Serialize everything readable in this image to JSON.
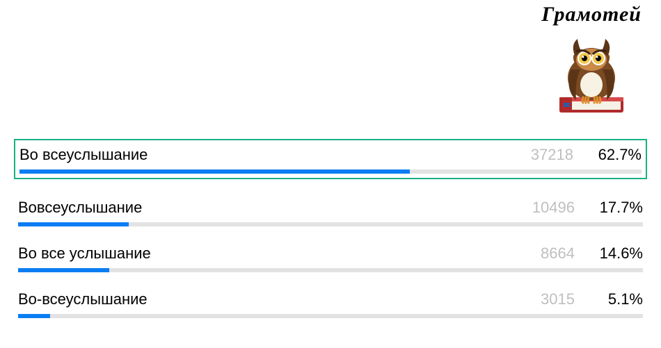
{
  "brand": {
    "title": "Грамотей"
  },
  "chart_data": {
    "type": "bar",
    "title": "",
    "xlabel": "",
    "ylabel": "",
    "categories": [
      "Во всеуслышание",
      "Вовсеуслышание",
      "Во все услышание",
      "Во-всеуслышание"
    ],
    "series": [
      {
        "name": "count",
        "values": [
          37218,
          10496,
          8664,
          3015
        ]
      },
      {
        "name": "percent",
        "values": [
          62.7,
          17.7,
          14.6,
          5.1
        ]
      }
    ],
    "highlighted_index": 0
  },
  "rows": [
    {
      "label": "Во всеуслышание",
      "count": "37218",
      "percent": "62.7%",
      "bar_width": "62.7%",
      "highlighted": true
    },
    {
      "label": "Вовсеуслышание",
      "count": "10496",
      "percent": "17.7%",
      "bar_width": "17.7%",
      "highlighted": false
    },
    {
      "label": "Во все услышание",
      "count": "8664",
      "percent": "14.6%",
      "bar_width": "14.6%",
      "highlighted": false
    },
    {
      "label": "Во-всеуслышание",
      "count": "3015",
      "percent": "5.1%",
      "bar_width": "5.1%",
      "highlighted": false
    }
  ]
}
